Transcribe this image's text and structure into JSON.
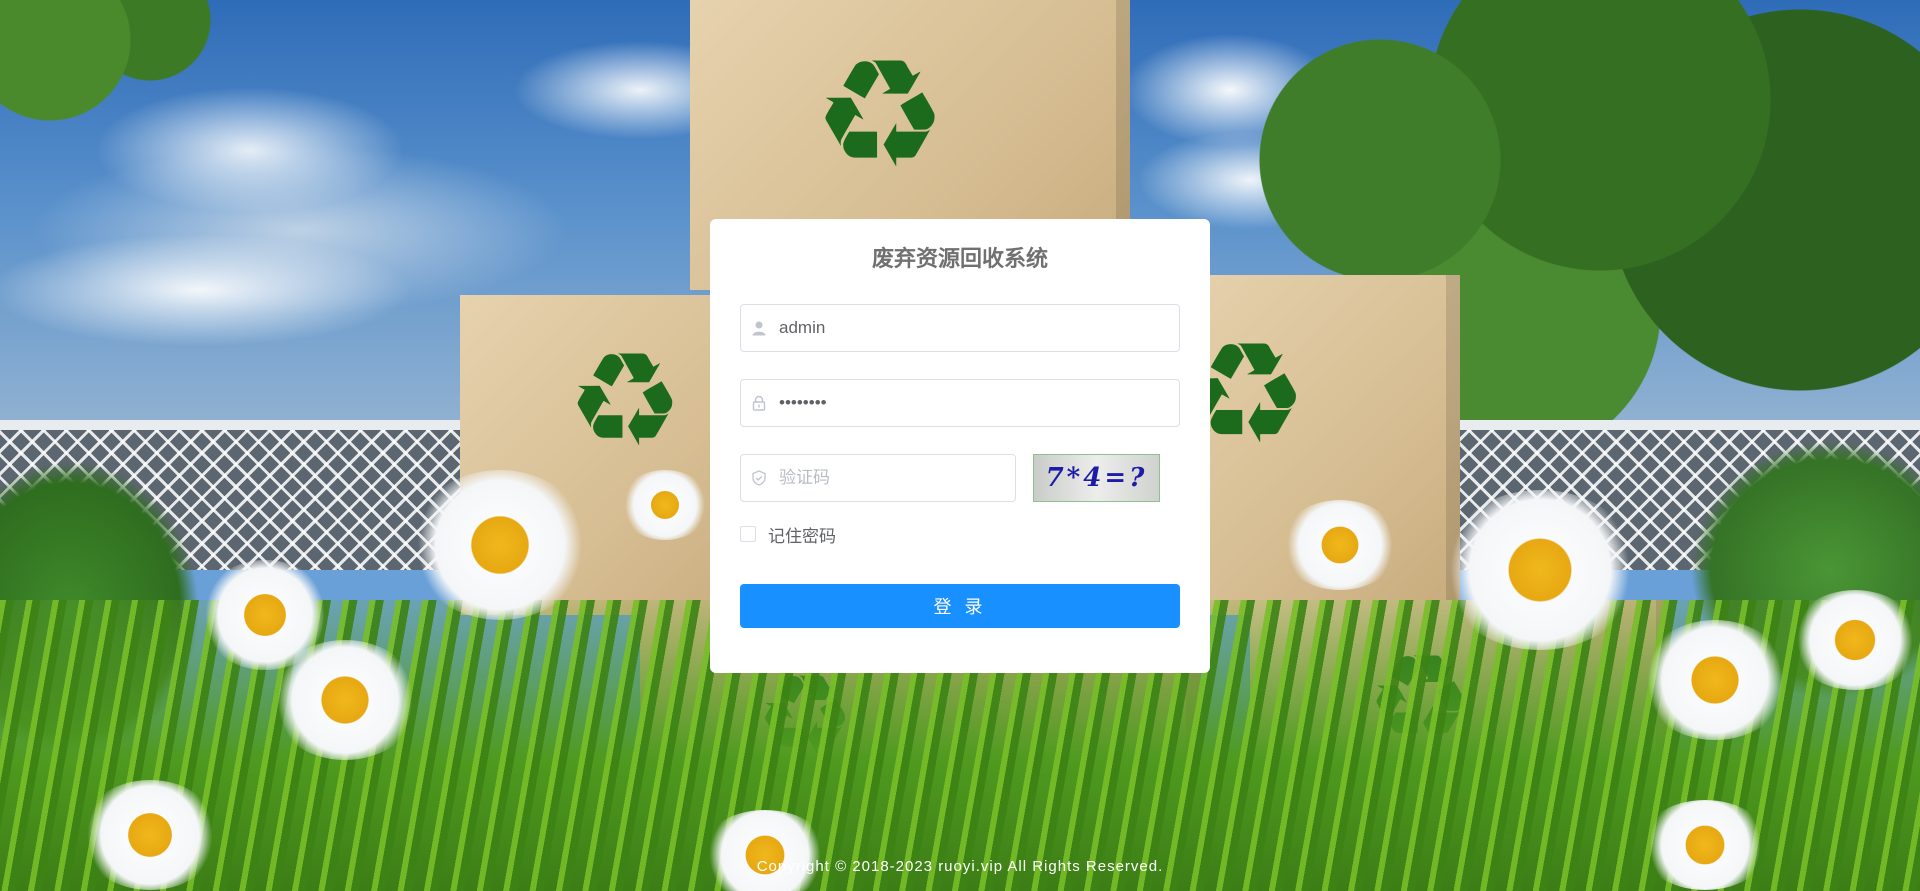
{
  "login": {
    "title": "废弃资源回收系统",
    "username_value": "admin",
    "password_value": "admin123",
    "captcha_placeholder": "验证码",
    "captcha_text": "7*4=?",
    "remember_label": "记住密码",
    "remember_checked": false,
    "submit_label": "登 录"
  },
  "footer": {
    "copyright": "Copyright © 2018-2023 ruoyi.vip All Rights Reserved."
  },
  "icons": {
    "user": "user-icon",
    "lock": "lock-icon",
    "shield": "shield-icon",
    "recycle": "recycle-icon"
  },
  "colors": {
    "primary": "#1890ff",
    "card_bg": "#ffffff",
    "title_text": "#707070",
    "recycle_green": "#1c6b1c"
  }
}
